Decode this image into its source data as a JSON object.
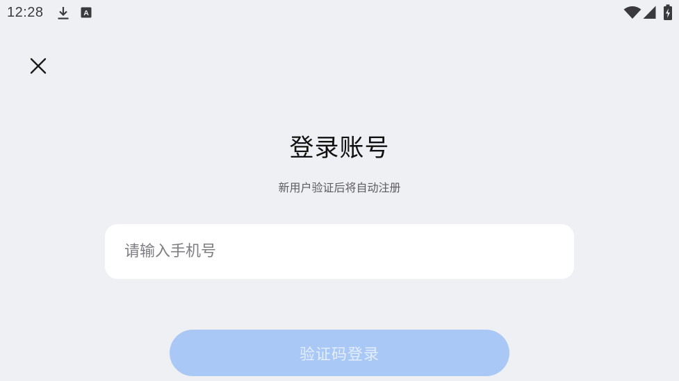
{
  "status_bar": {
    "time": "12:28",
    "icons": [
      "download-icon",
      "keyboard-a-icon",
      "wifi-icon",
      "signal-icon",
      "battery-charging-icon"
    ]
  },
  "close_icon": "close-icon",
  "login": {
    "title": "登录账号",
    "subtitle": "新用户验证后将自动注册",
    "phone_placeholder": "请输入手机号",
    "phone_value": "",
    "submit_label": "验证码登录"
  },
  "colors": {
    "background": "#eff0f3",
    "input_background": "#ffffff",
    "button_disabled": "#a9c8f6",
    "button_text": "#e3eefc"
  }
}
